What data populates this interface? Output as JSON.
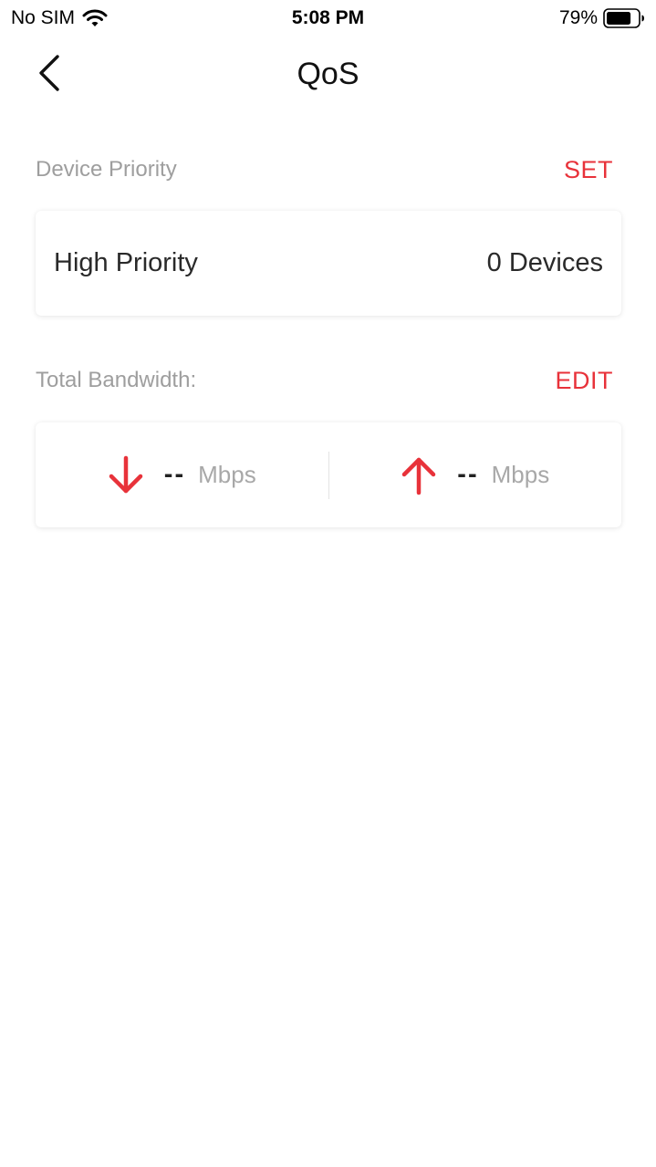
{
  "status_bar": {
    "carrier": "No SIM",
    "time": "5:08 PM",
    "battery_percent": "79%",
    "battery_level": 0.79,
    "icons": [
      "wifi-icon",
      "battery-icon"
    ]
  },
  "nav": {
    "title": "QoS",
    "back_icon": "chevron-left-icon"
  },
  "device_priority": {
    "label": "Device Priority",
    "action": "SET",
    "row_label": "High Priority",
    "row_value": "0 Devices"
  },
  "bandwidth": {
    "label": "Total Bandwidth:",
    "action": "EDIT",
    "download": {
      "icon": "arrow-down-icon",
      "value": "--",
      "unit": "Mbps"
    },
    "upload": {
      "icon": "arrow-up-icon",
      "value": "--",
      "unit": "Mbps"
    }
  },
  "colors": {
    "accent": "#e8323a",
    "label_gray": "#9e9e9e",
    "text_dark": "#2a2a2a"
  }
}
